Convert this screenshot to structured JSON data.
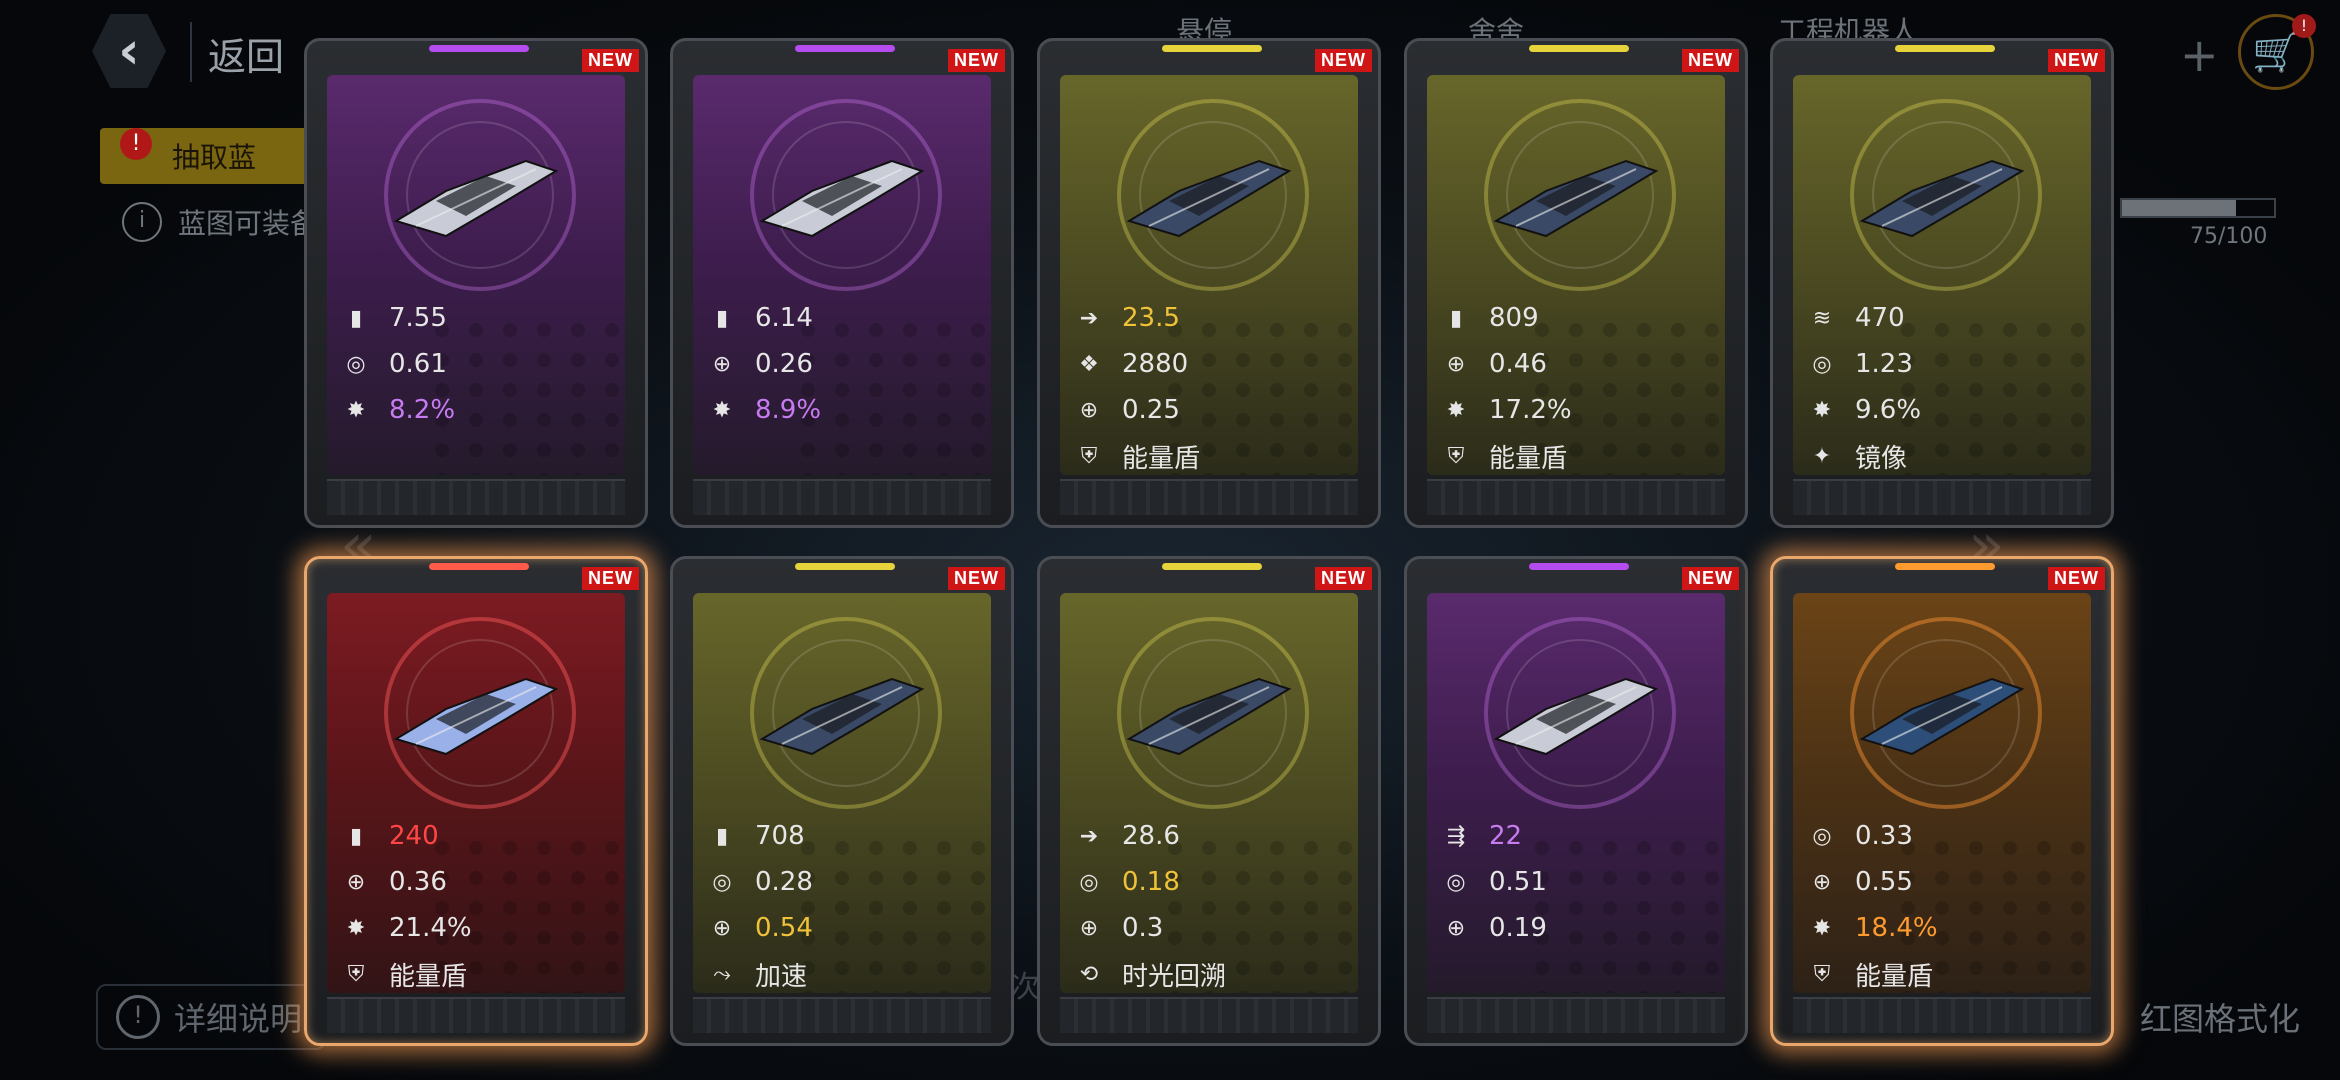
{
  "header": {
    "back_label": "返回",
    "tabs": [
      "悬停",
      "舍舍",
      "工程机器人"
    ],
    "plus": "+",
    "cart_badge": "!"
  },
  "background": {
    "draw_button_label": "抽取蓝",
    "info_text": "蓝图可装备",
    "progress_text": "75/100",
    "progress": 0.75,
    "detail_button_label": "详细说明",
    "format_button_label": "红图格式化"
  },
  "cards": [
    {
      "rarity": "purple",
      "badge": "NEW",
      "bar_color": "#b44cf0",
      "stats": [
        {
          "icon": "ammo-icon",
          "glyph": "▮",
          "value": "7.55",
          "tone": ""
        },
        {
          "icon": "firerate-icon",
          "glyph": "◎",
          "value": "0.61",
          "tone": ""
        },
        {
          "icon": "crit-icon",
          "glyph": "✸",
          "value": "8.2%",
          "tone": "purple"
        }
      ]
    },
    {
      "rarity": "purple",
      "badge": "NEW",
      "bar_color": "#b44cf0",
      "stats": [
        {
          "icon": "ammo-icon",
          "glyph": "▮",
          "value": "6.14",
          "tone": ""
        },
        {
          "icon": "accuracy-icon",
          "glyph": "⊕",
          "value": "0.26",
          "tone": ""
        },
        {
          "icon": "crit-icon",
          "glyph": "✸",
          "value": "8.9%",
          "tone": "purple"
        }
      ]
    },
    {
      "rarity": "olive",
      "badge": "NEW",
      "bar_color": "#e6d23a",
      "stats": [
        {
          "icon": "speed-icon",
          "glyph": "➔",
          "value": "23.5",
          "tone": "yellow"
        },
        {
          "icon": "cluster-icon",
          "glyph": "❖",
          "value": "2880",
          "tone": ""
        },
        {
          "icon": "accuracy-icon",
          "glyph": "⊕",
          "value": "0.25",
          "tone": ""
        },
        {
          "icon": "shield-icon",
          "glyph": "⛨",
          "value": "能量盾",
          "tone": ""
        }
      ]
    },
    {
      "rarity": "olive",
      "badge": "NEW",
      "bar_color": "#e6d23a",
      "stats": [
        {
          "icon": "ammo-icon",
          "glyph": "▮",
          "value": "809",
          "tone": ""
        },
        {
          "icon": "accuracy-icon",
          "glyph": "⊕",
          "value": "0.46",
          "tone": ""
        },
        {
          "icon": "crit-icon",
          "glyph": "✸",
          "value": "17.2%",
          "tone": ""
        },
        {
          "icon": "shield-icon",
          "glyph": "⛨",
          "value": "能量盾",
          "tone": ""
        }
      ]
    },
    {
      "rarity": "olive",
      "badge": "NEW",
      "bar_color": "#e6d23a",
      "stats": [
        {
          "icon": "fleet-icon",
          "glyph": "≋",
          "value": "470",
          "tone": ""
        },
        {
          "icon": "firerate-icon",
          "glyph": "◎",
          "value": "1.23",
          "tone": ""
        },
        {
          "icon": "crit-icon",
          "glyph": "✸",
          "value": "9.6%",
          "tone": ""
        },
        {
          "icon": "mirror-icon",
          "glyph": "✦",
          "value": "镜像",
          "tone": ""
        }
      ]
    },
    {
      "rarity": "red",
      "badge": "NEW",
      "bar_color": "#ff5a4a",
      "glow": true,
      "stats": [
        {
          "icon": "ammo-icon",
          "glyph": "▮",
          "value": "240",
          "tone": "red"
        },
        {
          "icon": "accuracy-icon",
          "glyph": "⊕",
          "value": "0.36",
          "tone": ""
        },
        {
          "icon": "crit-icon",
          "glyph": "✸",
          "value": "21.4%",
          "tone": ""
        },
        {
          "icon": "shield-icon",
          "glyph": "⛨",
          "value": "能量盾",
          "tone": ""
        }
      ]
    },
    {
      "rarity": "olive",
      "badge": "NEW",
      "bar_color": "#e6d23a",
      "stats": [
        {
          "icon": "ammo-icon",
          "glyph": "▮",
          "value": "708",
          "tone": ""
        },
        {
          "icon": "firerate-icon",
          "glyph": "◎",
          "value": "0.28",
          "tone": ""
        },
        {
          "icon": "accuracy-icon",
          "glyph": "⊕",
          "value": "0.54",
          "tone": "yellow"
        },
        {
          "icon": "boost-icon",
          "glyph": "⤳",
          "value": "加速",
          "tone": ""
        }
      ]
    },
    {
      "rarity": "olive",
      "badge": "NEW",
      "bar_color": "#e6d23a",
      "stats": [
        {
          "icon": "speed-icon",
          "glyph": "➔",
          "value": "28.6",
          "tone": ""
        },
        {
          "icon": "firerate-icon",
          "glyph": "◎",
          "value": "0.18",
          "tone": "yellow"
        },
        {
          "icon": "accuracy-icon",
          "glyph": "⊕",
          "value": "0.3",
          "tone": ""
        },
        {
          "icon": "time-rewind-icon",
          "glyph": "⟲",
          "value": "时光回溯",
          "tone": ""
        }
      ]
    },
    {
      "rarity": "purple",
      "badge": "NEW",
      "bar_color": "#b44cf0",
      "stats": [
        {
          "icon": "multi-shot-icon",
          "glyph": "⇶",
          "value": "22",
          "tone": "purple"
        },
        {
          "icon": "firerate-icon",
          "glyph": "◎",
          "value": "0.51",
          "tone": ""
        },
        {
          "icon": "accuracy-icon",
          "glyph": "⊕",
          "value": "0.19",
          "tone": ""
        }
      ]
    },
    {
      "rarity": "orange",
      "badge": "NEW",
      "bar_color": "#ff9a2e",
      "glow": true,
      "stats": [
        {
          "icon": "firerate-icon",
          "glyph": "◎",
          "value": "0.33",
          "tone": ""
        },
        {
          "icon": "accuracy-icon",
          "glyph": "⊕",
          "value": "0.55",
          "tone": ""
        },
        {
          "icon": "crit-icon",
          "glyph": "✸",
          "value": "18.4%",
          "tone": "orange"
        },
        {
          "icon": "shield-icon",
          "glyph": "⛨",
          "value": "能量盾",
          "tone": ""
        }
      ]
    }
  ]
}
